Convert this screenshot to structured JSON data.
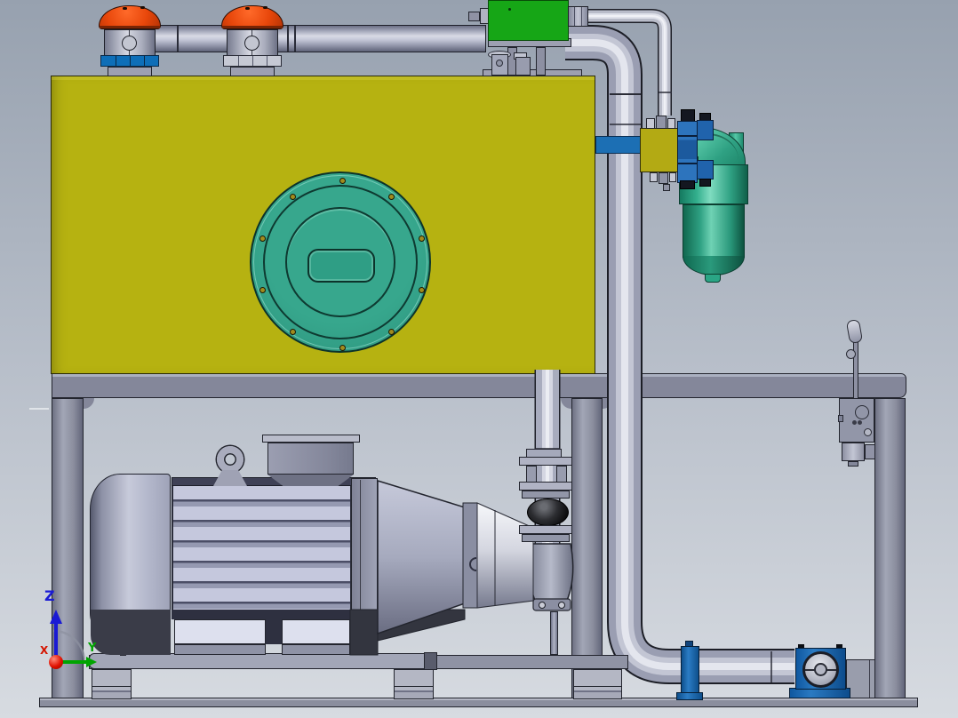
{
  "scene": {
    "description": "3D CAD viewport of a hydraulic power unit",
    "background": {
      "top": "#97a1af",
      "middle": "#b7bec9",
      "bottom": "#d7dbe1"
    }
  },
  "triad": {
    "x_label": "X",
    "y_label": "Y",
    "z_label": "Z",
    "x_color": "#d41400",
    "y_color": "#00a400",
    "z_color": "#1a1ad4"
  },
  "colors": {
    "bg_top": "#97a1af",
    "bg_mid": "#b7bec9",
    "bg_bottom": "#d7dbe1",
    "tank_yellow": "#b6b211",
    "cover_teal": "#2f9e85",
    "breather_orange": "#e8470b",
    "collar_blue": "#0e6eb8",
    "gauge_green": "#16a616",
    "pipe_gray": "#a3a7bb",
    "valve_blue": "#2063ac",
    "fitting_blue": "#1c6fb4",
    "filter_teal": "#2fa183",
    "frame_gray": "#84879a",
    "motor_lavender": "#b4b8d0",
    "manifold_yellow": "#b3aa14",
    "ball_black": "#17181c",
    "axis_x_red": "#d41400",
    "axis_y_green": "#00a400",
    "axis_z_blue": "#1a1ad4",
    "outline_dark": "#23252e"
  },
  "components": [
    {
      "name": "reservoir-tank",
      "color": "#b6b211"
    },
    {
      "name": "tank-access-cover",
      "color": "#2f9e85"
    },
    {
      "name": "breather-cap-left",
      "color": "#e8470b"
    },
    {
      "name": "breather-cap-right",
      "color": "#e8470b"
    },
    {
      "name": "top-header-pipe",
      "color": "#a3a7bb"
    },
    {
      "name": "level-gauge-box",
      "color": "#16a616"
    },
    {
      "name": "return-pipe",
      "color": "#a3a7bb"
    },
    {
      "name": "suction-pipe",
      "color": "#a3a7bb"
    },
    {
      "name": "rubber-expansion-joint",
      "color": "#17181c"
    },
    {
      "name": "electric-motor",
      "color": "#b4b8d0"
    },
    {
      "name": "bell-housing"
    },
    {
      "name": "hydraulic-pump"
    },
    {
      "name": "return-filter",
      "color": "#2fa183"
    },
    {
      "name": "directional-valve-stack",
      "color": "#2063ac"
    },
    {
      "name": "manifold-block",
      "color": "#b3aa14"
    },
    {
      "name": "pipe-clamp-flange",
      "color": "#1c6fb4"
    },
    {
      "name": "pump-support-block",
      "color": "#1c6fb4"
    },
    {
      "name": "hand-lever-valve"
    },
    {
      "name": "base-frame",
      "color": "#84879a"
    },
    {
      "name": "motor-mounting-plate"
    },
    {
      "name": "vibration-isolator-feet"
    },
    {
      "name": "origin-triad"
    }
  ]
}
